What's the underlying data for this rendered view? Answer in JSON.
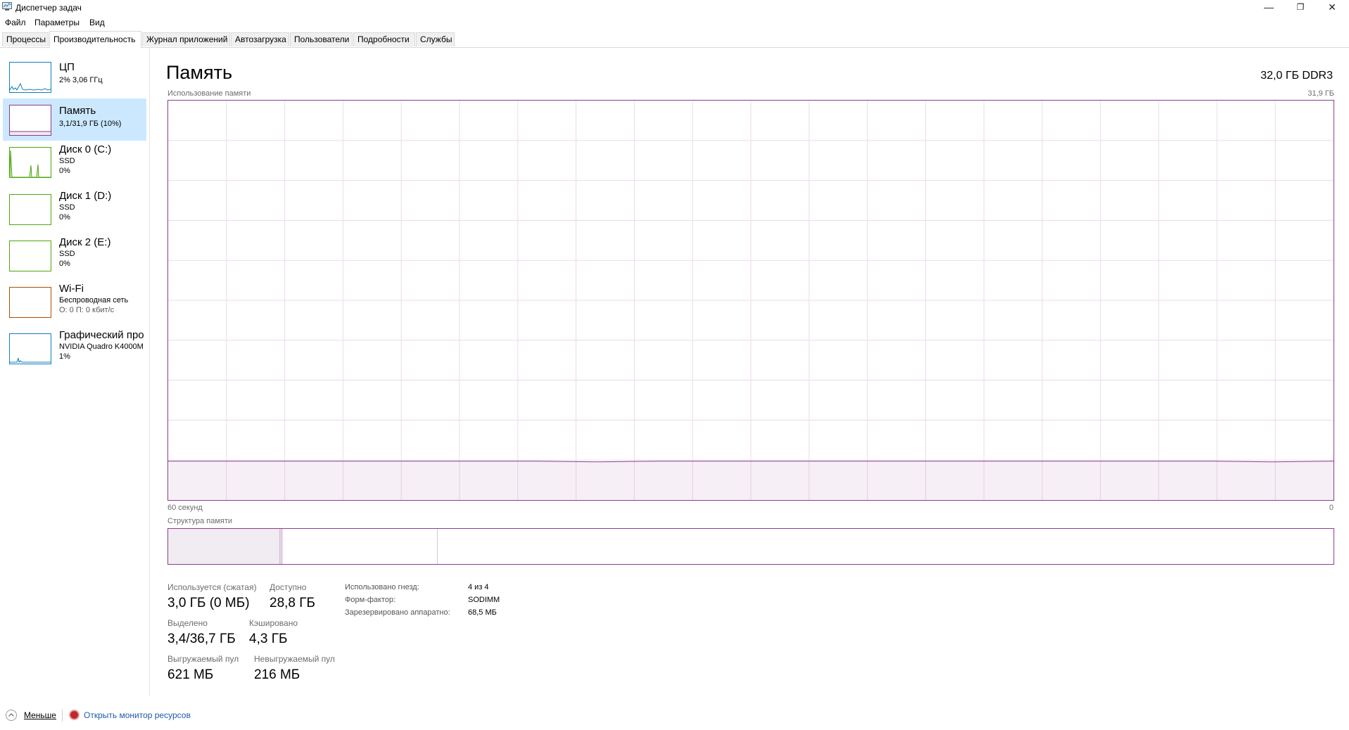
{
  "window": {
    "title": "Диспетчер задач",
    "controls": {
      "minimize": "—",
      "restore": "❐",
      "close": "✕"
    }
  },
  "menu": [
    "Файл",
    "Параметры",
    "Вид"
  ],
  "tabs": [
    {
      "label": "Процессы"
    },
    {
      "label": "Производительность",
      "active": true
    },
    {
      "label": "Журнал приложений"
    },
    {
      "label": "Автозагрузка"
    },
    {
      "label": "Пользователи"
    },
    {
      "label": "Подробности"
    },
    {
      "label": "Службы"
    }
  ],
  "sidebar": {
    "items": [
      {
        "title": "ЦП",
        "line1": "2% 3,06 ГГц",
        "line2": "",
        "color": "#117dbb",
        "icon": "cpu-graph",
        "selected": false
      },
      {
        "title": "Память",
        "line1": "3,1/31,9 ГБ (10%)",
        "line2": "",
        "color": "#8b3d8b",
        "icon": "memory-graph",
        "selected": true
      },
      {
        "title": "Диск 0 (C:)",
        "line1": "SSD",
        "line2": "0%",
        "color": "#4da60c",
        "icon": "disk-graph",
        "selected": false
      },
      {
        "title": "Диск 1 (D:)",
        "line1": "SSD",
        "line2": "0%",
        "color": "#4da60c",
        "icon": "disk-graph",
        "selected": false
      },
      {
        "title": "Диск 2 (E:)",
        "line1": "SSD",
        "line2": "0%",
        "color": "#4da60c",
        "icon": "disk-graph",
        "selected": false
      },
      {
        "title": "Wi-Fi",
        "line1": "Беспроводная сеть",
        "line2": "О: 0 П: 0 кбит/с",
        "color": "#a74f01",
        "icon": "network-graph",
        "selected": false
      },
      {
        "title": "Графический про",
        "line1": "NVIDIA Quadro K4000M",
        "line2": "1%",
        "color": "#117dbb",
        "icon": "gpu-graph",
        "selected": false
      }
    ]
  },
  "main": {
    "title": "Память",
    "spec": "32,0 ГБ DDR3",
    "chart_label": "Использование памяти",
    "chart_max": "31,9 ГБ",
    "time_left": "60 секунд",
    "time_right": "0",
    "structure_label": "Структура памяти"
  },
  "chart_data": {
    "type": "area",
    "title": "Использование памяти",
    "x_range_label": [
      "60 секунд",
      "0"
    ],
    "ymax_label": "31,9 ГБ",
    "y_unit": "ГБ",
    "ylim": [
      0,
      31.9
    ],
    "grid": true,
    "color": "#8b3d8b",
    "values": [
      3.1,
      3.1,
      3.1,
      3.1,
      3.1,
      3.1,
      3.1,
      3.05,
      3.1,
      3.1,
      3.1,
      3.1,
      3.1,
      3.1,
      3.1,
      3.1,
      3.1,
      3.1,
      3.05,
      3.1
    ]
  },
  "structure_data": {
    "segments": [
      {
        "part": "in-use",
        "fraction": 0.096
      },
      {
        "part": "modified",
        "fraction": 0.002
      },
      {
        "part": "standby",
        "fraction": 0.133
      },
      {
        "part": "free",
        "fraction": 0.769
      }
    ]
  },
  "stats": {
    "in_use_label": "Используется (сжатая)",
    "in_use_value": "3,0 ГБ (0 МБ)",
    "available_label": "Доступно",
    "available_value": "28,8 ГБ",
    "committed_label": "Выделено",
    "committed_value": "3,4/36,7 ГБ",
    "cached_label": "Кэшировано",
    "cached_value": "4,3 ГБ",
    "paged_label": "Выгружаемый пул",
    "paged_value": "621 МБ",
    "nonpaged_label": "Невыгружаемый пул",
    "nonpaged_value": "216 МБ"
  },
  "info": {
    "slots_label": "Использовано гнезд:",
    "slots_value": "4 из 4",
    "form_label": "Форм-фактор:",
    "form_value": "SODIMM",
    "reserved_label": "Зарезервировано аппаратно:",
    "reserved_value": "68,5 МБ"
  },
  "footer": {
    "less_label": "Меньше",
    "monitor_link": "Открыть монитор ресурсов"
  }
}
